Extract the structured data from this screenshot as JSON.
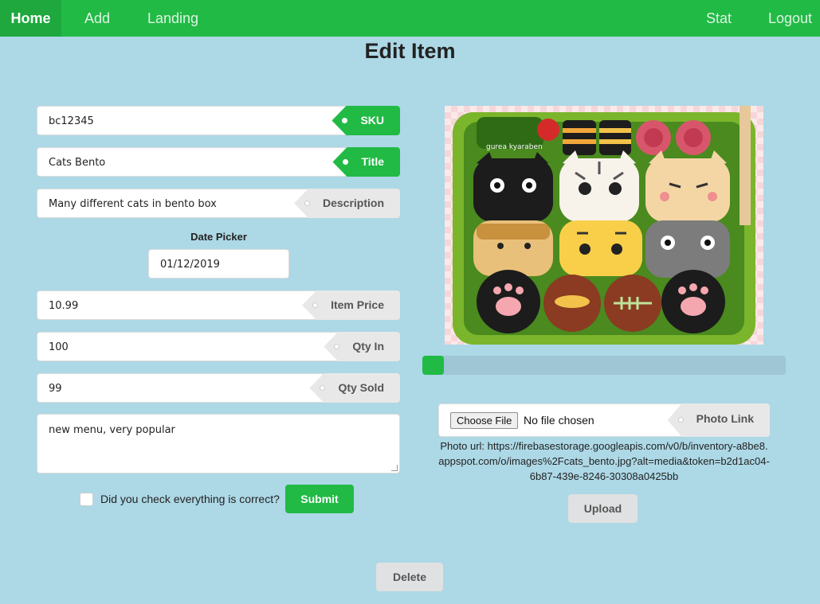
{
  "nav": {
    "home": "Home",
    "add": "Add",
    "landing": "Landing",
    "stat": "Stat",
    "logout": "Logout"
  },
  "page": {
    "title": "Edit Item"
  },
  "form": {
    "sku": {
      "value": "bc12345",
      "label": "SKU"
    },
    "title": {
      "value": "Cats Bento",
      "label": "Title"
    },
    "description": {
      "value": "Many different cats in bento box",
      "label": "Description"
    },
    "date_picker": {
      "label": "Date Picker",
      "value": "01/12/2019"
    },
    "item_price": {
      "value": "10.99",
      "label": "Item Price"
    },
    "qty_in": {
      "value": "100",
      "label": "Qty In"
    },
    "qty_sold": {
      "value": "99",
      "label": "Qty Sold"
    },
    "notes": {
      "value": "new menu, very popular"
    },
    "confirm_label": "Did you check everything is correct?",
    "submit_label": "Submit"
  },
  "upload": {
    "progress_percent": 6,
    "choose_file_label": "Choose File",
    "no_file_text": "No file chosen",
    "photo_link_label": "Photo Link",
    "photo_url_text": "Photo url: https://firebasestorage.googleapis.com/v0/b/inventory-a8be8.appspot.com/o/images%2Fcats_bento.jpg?alt=media&token=b2d1ac04-6b87-439e-8246-30308a0425bb",
    "upload_label": "Upload",
    "image_caption": "gurea kyaraben"
  },
  "actions": {
    "delete_label": "Delete"
  },
  "colors": {
    "nav": "#21ba45",
    "background": "#add8e6",
    "accent": "#21ba45"
  }
}
